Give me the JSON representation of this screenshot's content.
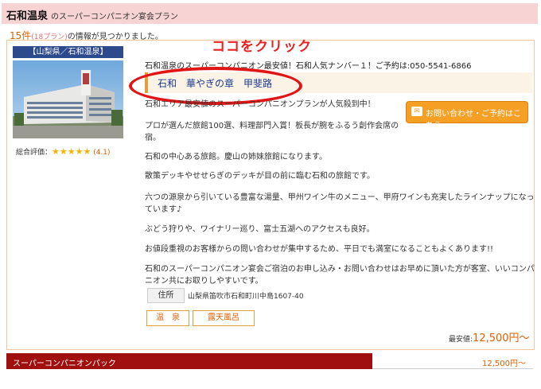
{
  "header": {
    "title": "石和温泉",
    "subtitle": "のスーパーコンパニオン宴会プラン"
  },
  "results": {
    "count": "15件",
    "plans": "(18プラン)",
    "suffix": "の情報が見つかりました。"
  },
  "annotation": {
    "click_here": "ココをクリック"
  },
  "listing": {
    "region": "【山梨県／石和温泉】",
    "rating_label": "総合評価：",
    "rating_stars": 4,
    "rating_score": "(4.1)",
    "promo": "石和温泉のスーパーコンパニオン最安値！石和人気ナンバー１！ご予約は:050-5541-6866",
    "plan_name": "石和　華やぎの章　甲斐路",
    "paragraphs": [
      "石和エリア最安値のスーパーコンパニオンプランが人気殺到中！",
      "プロが選んだ旅館100選、料理部門入賞！板長が腕をふるう創作会席の宿。",
      "石和の中心ある旅館。慶山の姉妹旅館になります。",
      "散策デッキやせせらぎのデッキが目の前に臨む石和の旅館です。",
      "六つの源泉から引いている豊富な湯量、甲州ワイン牛のメニュー、甲府ワインも充実したラインナップになっています♪",
      "ぶどう狩りや、ワイナリー巡り、富士五湖へのアクセスも良好。",
      "お値段重視のお客様からの問い合わせが集中するため、平日でも満室になることもよくあります!!",
      "石和のスーパーコンパニオン宴会ご宿泊のお申し込み・お問い合わせはお早めに頂いた方が客室、いいコンパニオン共にお取りしやすいです。"
    ],
    "cta_label": "お問い合わせ・ご予約はこちら",
    "address_label": "住所",
    "address": "山梨県笛吹市石和町川中島1607-40",
    "tags": [
      "温　泉",
      "露天風呂"
    ],
    "lowest_label": "最安値:",
    "lowest_price": "12,500円〜"
  },
  "package": {
    "name": "スーパーコンパニオンパック",
    "price": "12,500円〜"
  },
  "colors": {
    "title_bg": "#f8d3d3",
    "accent": "#e06000",
    "region_bg": "#2c4a8c",
    "annotation": "#e01515",
    "package_bg": "#a01010",
    "cta": "#f5a025"
  }
}
